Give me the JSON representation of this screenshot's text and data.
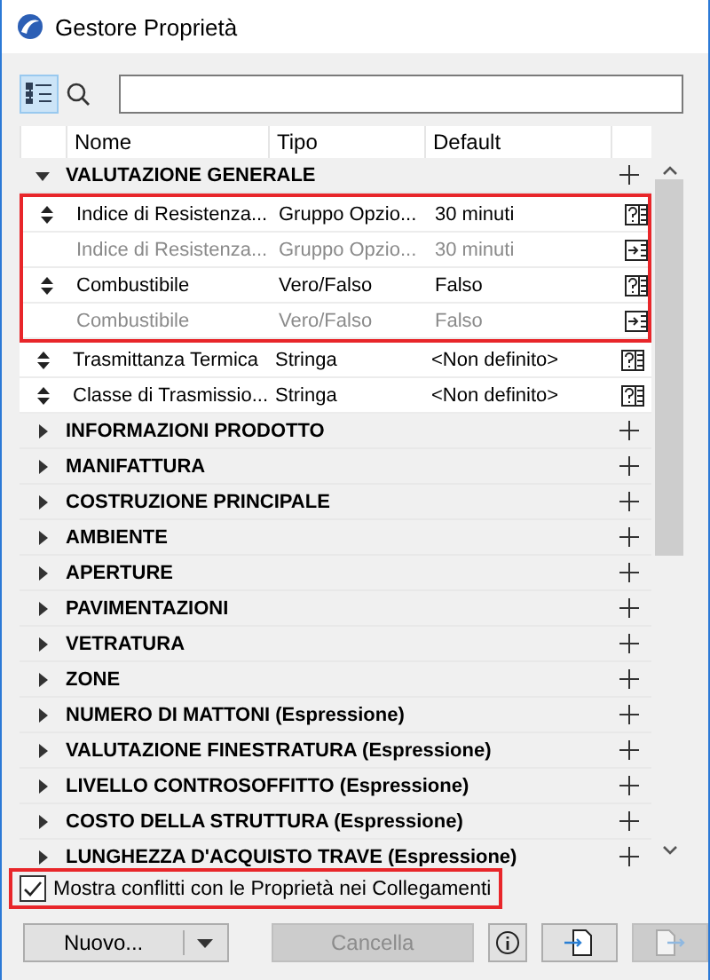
{
  "window": {
    "title": "Gestore Proprietà"
  },
  "toolbar": {
    "tree_view_selected": true
  },
  "table": {
    "columns": [
      "Nome",
      "Tipo",
      "Default"
    ],
    "groups": [
      {
        "name": "VALUTAZIONE GENERALE",
        "expanded": true,
        "properties": [
          {
            "name": "Indice di Resistenza...",
            "type": "Gruppo Opzio...",
            "default": "30 minuti",
            "linked": false,
            "highlighted": true
          },
          {
            "name": "Indice di Resistenza...",
            "type": "Gruppo Opzio...",
            "default": "30 minuti",
            "linked": true,
            "highlighted": true
          },
          {
            "name": "Combustibile",
            "type": "Vero/Falso",
            "default": "Falso",
            "linked": false,
            "highlighted": true
          },
          {
            "name": "Combustibile",
            "type": "Vero/Falso",
            "default": "Falso",
            "linked": true,
            "highlighted": true
          },
          {
            "name": "Trasmittanza Termica",
            "type": "Stringa",
            "default": "<Non definito>",
            "linked": false,
            "highlighted": false
          },
          {
            "name": "Classe di Trasmissio...",
            "type": "Stringa",
            "default": "<Non definito>",
            "linked": false,
            "highlighted": false
          }
        ]
      },
      {
        "name": "INFORMAZIONI PRODOTTO",
        "expanded": false
      },
      {
        "name": "MANIFATTURA",
        "expanded": false
      },
      {
        "name": "COSTRUZIONE PRINCIPALE",
        "expanded": false
      },
      {
        "name": "AMBIENTE",
        "expanded": false
      },
      {
        "name": "APERTURE",
        "expanded": false
      },
      {
        "name": "PAVIMENTAZIONI",
        "expanded": false
      },
      {
        "name": "VETRATURA",
        "expanded": false
      },
      {
        "name": "ZONE",
        "expanded": false
      },
      {
        "name": "NUMERO DI MATTONI (Espressione)",
        "expanded": false
      },
      {
        "name": "VALUTAZIONE FINESTRATURA (Espressione)",
        "expanded": false
      },
      {
        "name": "LIVELLO CONTROSOFFITTO (Espressione)",
        "expanded": false
      },
      {
        "name": "COSTO DELLA STRUTTURA (Espressione)",
        "expanded": false
      },
      {
        "name": "LUNGHEZZA D'ACQUISTO TRAVE (Espressione)",
        "expanded": false
      }
    ]
  },
  "show_conflicts": {
    "label": "Mostra conflitti con le Proprietà nei Collegamenti",
    "checked": true,
    "highlighted": true
  },
  "buttons": {
    "new": {
      "label": "Nuovo..."
    },
    "delete": {
      "label": "Cancella",
      "disabled": true
    },
    "import_disabled": false,
    "export_disabled": true
  }
}
